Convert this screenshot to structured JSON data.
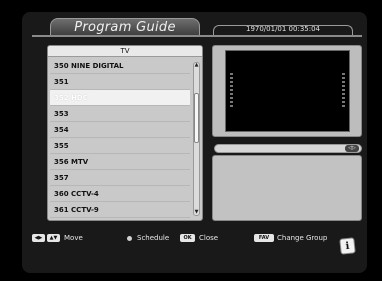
{
  "header": {
    "title": "Program Guide",
    "datetime": "1970/01/01 00:35:04"
  },
  "list": {
    "category": "TV",
    "channels": [
      {
        "label": "350 NINE DIGITAL",
        "selected": false
      },
      {
        "label": "351",
        "selected": false
      },
      {
        "label": "352 HDC",
        "selected": true
      },
      {
        "label": "353",
        "selected": false
      },
      {
        "label": "354",
        "selected": false
      },
      {
        "label": "355",
        "selected": false
      },
      {
        "label": "356 MTV",
        "selected": false
      },
      {
        "label": "357",
        "selected": false
      },
      {
        "label": "360 CCTV-4",
        "selected": false
      },
      {
        "label": "361 CCTV-9",
        "selected": false
      }
    ]
  },
  "footer": {
    "move_label": "Move",
    "schedule_label": "Schedule",
    "ok_key": "OK",
    "close_label": "Close",
    "fav_key": "FAV",
    "change_group_label": "Change Group"
  },
  "icons": {
    "lr_keys": "◀▶",
    "ud_keys": "▲▼",
    "info": "i"
  },
  "colors": {
    "selection": "#f1f1f1",
    "panel": "#c9c9c9",
    "background": "#191919"
  }
}
